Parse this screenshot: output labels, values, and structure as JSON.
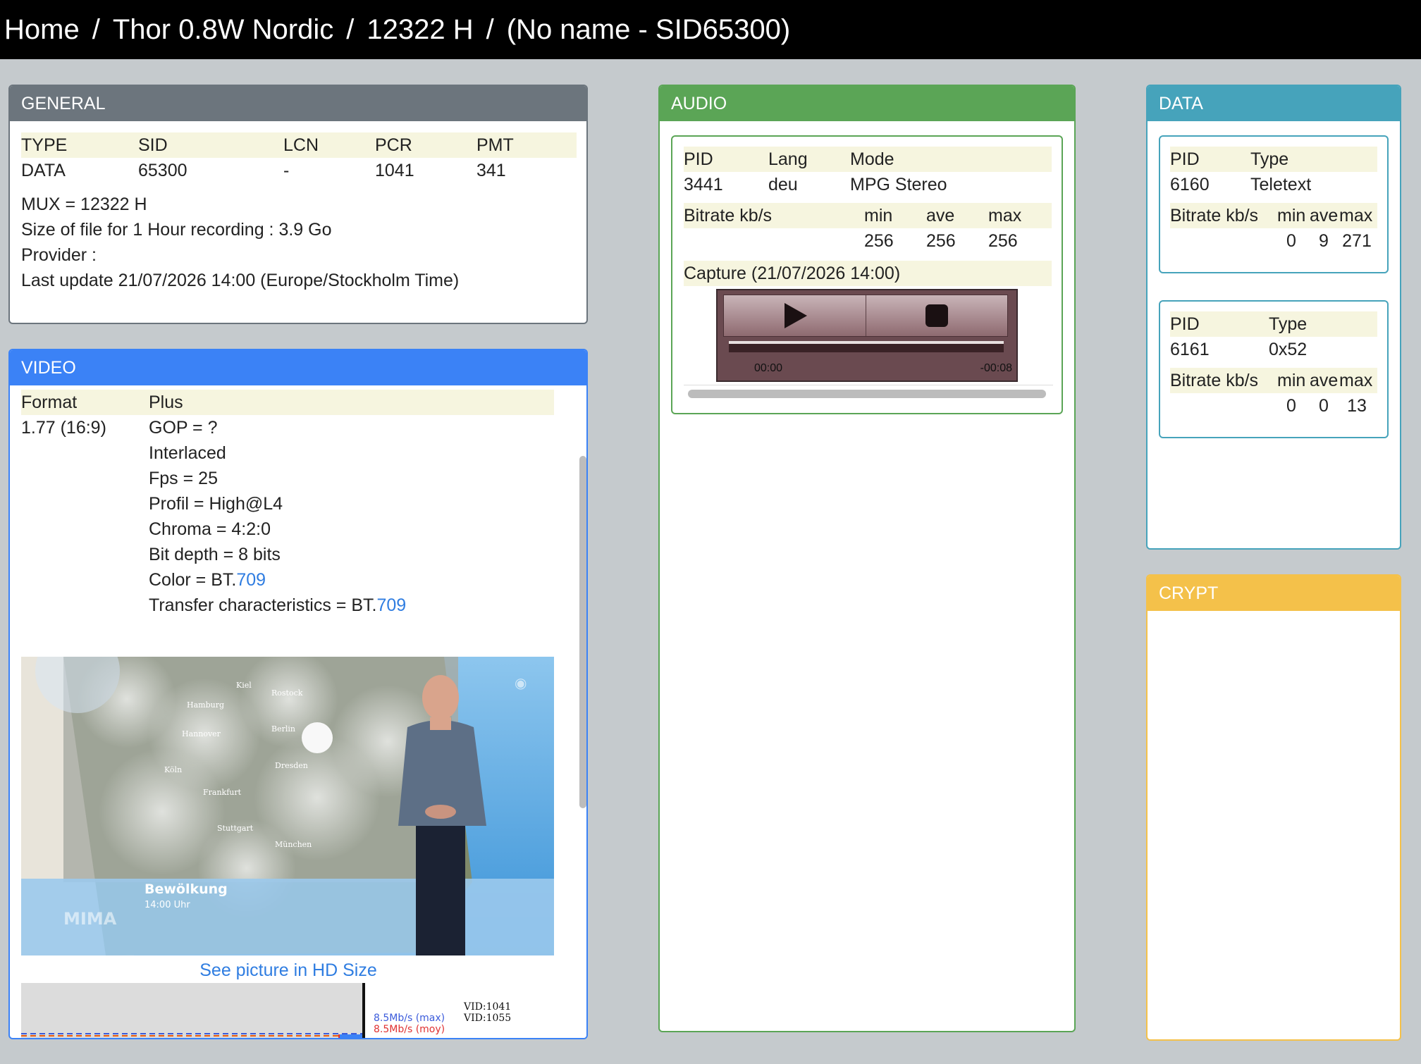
{
  "breadcrumb": {
    "home": "Home",
    "sep": "/",
    "satellite": "Thor 0.8W Nordic",
    "mux": "12322 H",
    "channel": "(No name - SID65300)"
  },
  "general": {
    "title": "GENERAL",
    "headers": [
      "TYPE",
      "SID",
      "LCN",
      "PCR",
      "PMT"
    ],
    "values": [
      "DATA",
      "65300",
      "-",
      "1041",
      "341"
    ],
    "mux": "MUX = 12322 H",
    "size": "Size of file for 1 Hour recording : 3.9 Go",
    "provider": "Provider :",
    "last_update": "Last update 21/07/2026 14:00 (Europe/Stockholm Time)"
  },
  "video": {
    "title": "VIDEO",
    "headers": [
      "Format",
      "Plus"
    ],
    "format": "1.77 (16:9)",
    "plus": [
      "GOP = ?",
      "Interlaced",
      "Fps = 25",
      "Profil = High@L4",
      "Chroma = 4:2:0",
      "Bit depth = 8 bits"
    ],
    "color_prefix": "Color = BT.",
    "color_link": "709",
    "transfer_prefix": "Transfer characteristics = BT.",
    "transfer_link": "709",
    "hd_link": "See picture in HD Size",
    "image": {
      "caption": "Bewölkung",
      "caption_time": "14:00 Uhr",
      "mima": "MIMA",
      "cities": [
        "Kiel",
        "Rostock",
        "Hamburg",
        "Hannover",
        "Berlin",
        "Köln",
        "Dresden",
        "Frankfurt",
        "Stuttgart",
        "München"
      ]
    },
    "graph": {
      "max_label": "8.5Mb/s (max)",
      "moy_label": "8.5Mb/s (moy)",
      "vid1": "VID:1041",
      "vid2": "VID:1055"
    }
  },
  "audio": {
    "title": "AUDIO",
    "headers": [
      "PID",
      "Lang",
      "Mode"
    ],
    "values": [
      "3441",
      "deu",
      "MPG Stereo"
    ],
    "bitrate_label": "Bitrate kb/s",
    "bitrate_headers": [
      "min",
      "ave",
      "max"
    ],
    "bitrate_values": [
      "256",
      "256",
      "256"
    ],
    "capture": "Capture (21/07/2026 14:00)",
    "player_time_start": "00:00",
    "player_time_end": "-00:08"
  },
  "data": {
    "title": "DATA",
    "streams": [
      {
        "headers": [
          "PID",
          "Type"
        ],
        "values": [
          "6160",
          "Teletext"
        ],
        "bitrate_label": "Bitrate kb/s",
        "bitrate_headers": [
          "min",
          "ave",
          "max"
        ],
        "bitrate_values": [
          "0",
          "9",
          "271"
        ]
      },
      {
        "headers": [
          "PID",
          "Type"
        ],
        "values": [
          "6161",
          "0x52"
        ],
        "bitrate_label": "Bitrate kb/s",
        "bitrate_headers": [
          "min",
          "ave",
          "max"
        ],
        "bitrate_values": [
          "0",
          "0",
          "13"
        ]
      }
    ]
  },
  "crypt": {
    "title": "CRYPT"
  },
  "colors": {
    "general": "#6c757d",
    "video": "#3b82f6",
    "audio": "#5ba556",
    "data": "#46a3bb",
    "crypt": "#f4c14a",
    "link": "#2f7de1"
  }
}
